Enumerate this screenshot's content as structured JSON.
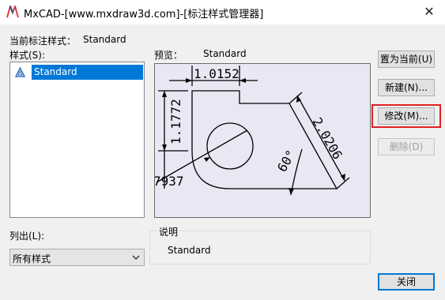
{
  "window": {
    "title": "MxCAD-[www.mxdraw3d.com]-[标注样式管理器]",
    "close_glyph": "✕",
    "app_icon": "mxcad-logo-icon"
  },
  "current_style": {
    "label": "当前标注样式：",
    "value": "Standard"
  },
  "styles": {
    "label": "样式(S):",
    "items": [
      {
        "label": "Standard",
        "selected": true,
        "icon": "dimstyle-icon"
      }
    ]
  },
  "preview": {
    "label": "预览：",
    "style_name": "Standard",
    "dims": {
      "top_width": "1.0152",
      "left_height": "1.1772",
      "slant": "2.0206",
      "angle": "60°",
      "radius_partial": "7937"
    }
  },
  "list_filter": {
    "label": "列出(L):",
    "selected": "所有样式"
  },
  "description": {
    "title": "说明",
    "text": "Standard"
  },
  "buttons": {
    "set_current": "置为当前(U)",
    "new": "新建(N)...",
    "modify": "修改(M)...",
    "delete": "删除(D)",
    "close": "关闭"
  },
  "colors": {
    "accent": "#0078d7",
    "highlight": "#e02020",
    "preview_bg": "#e8e8f4"
  }
}
